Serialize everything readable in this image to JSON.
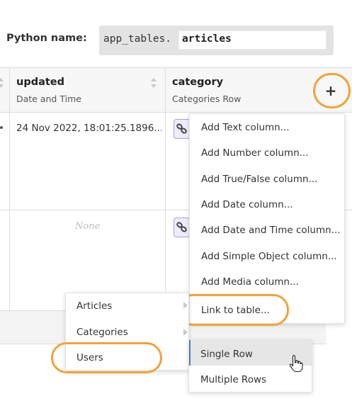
{
  "python_name": {
    "label": "Python name:",
    "prefix": "app_tables.",
    "value": "articles"
  },
  "table": {
    "columns": [
      {
        "name": "updated",
        "type": "Date and Time"
      },
      {
        "name": "category",
        "type": "Categories Row"
      }
    ],
    "rows": [
      {
        "updated": "24 Nov 2022, 18:01:25.1896..."
      },
      {
        "updated": "None"
      }
    ],
    "add_column_icon": "+"
  },
  "add_column_menu": {
    "items": [
      "Add Text column...",
      "Add Number column...",
      "Add True/False column...",
      "Add Date column...",
      "Add Date and Time column...",
      "Add Simple Object column...",
      "Add Media column...",
      "Link to table..."
    ]
  },
  "table_menu": {
    "items": [
      "Articles",
      "Categories",
      "Users"
    ]
  },
  "row_type_menu": {
    "items": [
      "Single Row",
      "Multiple Rows"
    ]
  },
  "colors": {
    "highlight_ring": "#f2a33a",
    "link_chip_border": "#a9a3d6",
    "selected_item_bg": "#e6e6e6",
    "selected_item_bar": "#4a7fb8"
  }
}
